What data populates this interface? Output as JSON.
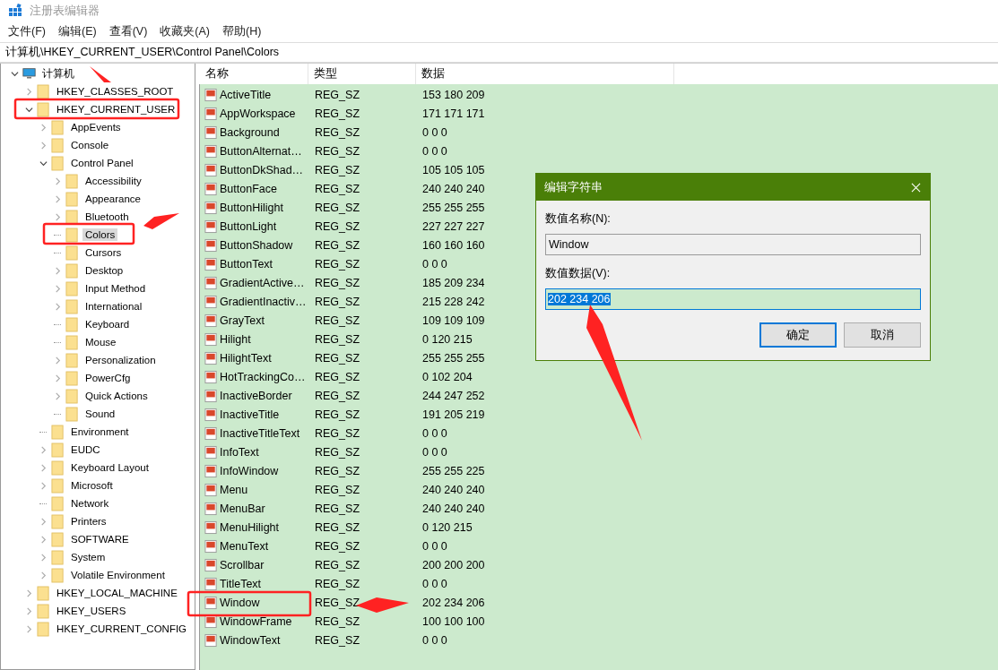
{
  "window": {
    "title": "注册表编辑器"
  },
  "menu": [
    "文件(F)",
    "编辑(E)",
    "查看(V)",
    "收藏夹(A)",
    "帮助(H)"
  ],
  "address": "计算机\\HKEY_CURRENT_USER\\Control Panel\\Colors",
  "tree": [
    {
      "label": "计算机",
      "kind": "computer",
      "expanded": true,
      "selected": false,
      "children": [
        {
          "label": "HKEY_CLASSES_ROOT",
          "expanded": false,
          "selected": false
        },
        {
          "label": "HKEY_CURRENT_USER",
          "expanded": true,
          "selected": false,
          "children": [
            {
              "label": "AppEvents",
              "expanded": false,
              "selected": false
            },
            {
              "label": "Console",
              "expanded": false,
              "selected": false
            },
            {
              "label": "Control Panel",
              "expanded": true,
              "selected": false,
              "children": [
                {
                  "label": "Accessibility",
                  "expanded": false,
                  "selected": false
                },
                {
                  "label": "Appearance",
                  "expanded": false,
                  "selected": false
                },
                {
                  "label": "Bluetooth",
                  "expanded": false,
                  "selected": false
                },
                {
                  "label": "Colors",
                  "kind": "leaf",
                  "selected": true
                },
                {
                  "label": "Cursors",
                  "kind": "leaf",
                  "selected": false
                },
                {
                  "label": "Desktop",
                  "expanded": false,
                  "selected": false
                },
                {
                  "label": "Input Method",
                  "expanded": false,
                  "selected": false
                },
                {
                  "label": "International",
                  "expanded": false,
                  "selected": false
                },
                {
                  "label": "Keyboard",
                  "kind": "leaf",
                  "selected": false
                },
                {
                  "label": "Mouse",
                  "kind": "leaf",
                  "selected": false
                },
                {
                  "label": "Personalization",
                  "expanded": false,
                  "selected": false
                },
                {
                  "label": "PowerCfg",
                  "expanded": false,
                  "selected": false
                },
                {
                  "label": "Quick Actions",
                  "expanded": false,
                  "selected": false
                },
                {
                  "label": "Sound",
                  "kind": "leaf",
                  "selected": false
                }
              ]
            },
            {
              "label": "Environment",
              "kind": "leaf",
              "selected": false
            },
            {
              "label": "EUDC",
              "expanded": false,
              "selected": false
            },
            {
              "label": "Keyboard Layout",
              "expanded": false,
              "selected": false
            },
            {
              "label": "Microsoft",
              "expanded": false,
              "selected": false
            },
            {
              "label": "Network",
              "kind": "leaf",
              "selected": false
            },
            {
              "label": "Printers",
              "expanded": false,
              "selected": false
            },
            {
              "label": "SOFTWARE",
              "expanded": false,
              "selected": false
            },
            {
              "label": "System",
              "expanded": false,
              "selected": false
            },
            {
              "label": "Volatile Environment",
              "expanded": false,
              "selected": false
            }
          ]
        },
        {
          "label": "HKEY_LOCAL_MACHINE",
          "expanded": false,
          "selected": false
        },
        {
          "label": "HKEY_USERS",
          "expanded": false,
          "selected": false
        },
        {
          "label": "HKEY_CURRENT_CONFIG",
          "expanded": false,
          "selected": false
        }
      ]
    }
  ],
  "table": {
    "columns": [
      "名称",
      "类型",
      "数据"
    ],
    "rows": [
      [
        "ActiveTitle",
        "REG_SZ",
        "153 180 209"
      ],
      [
        "AppWorkspace",
        "REG_SZ",
        "171 171 171"
      ],
      [
        "Background",
        "REG_SZ",
        "0 0 0"
      ],
      [
        "ButtonAlternat…",
        "REG_SZ",
        "0 0 0"
      ],
      [
        "ButtonDkShad…",
        "REG_SZ",
        "105 105 105"
      ],
      [
        "ButtonFace",
        "REG_SZ",
        "240 240 240"
      ],
      [
        "ButtonHilight",
        "REG_SZ",
        "255 255 255"
      ],
      [
        "ButtonLight",
        "REG_SZ",
        "227 227 227"
      ],
      [
        "ButtonShadow",
        "REG_SZ",
        "160 160 160"
      ],
      [
        "ButtonText",
        "REG_SZ",
        "0 0 0"
      ],
      [
        "GradientActive…",
        "REG_SZ",
        "185 209 234"
      ],
      [
        "GradientInactiv…",
        "REG_SZ",
        "215 228 242"
      ],
      [
        "GrayText",
        "REG_SZ",
        "109 109 109"
      ],
      [
        "Hilight",
        "REG_SZ",
        "0 120 215"
      ],
      [
        "HilightText",
        "REG_SZ",
        "255 255 255"
      ],
      [
        "HotTrackingCo…",
        "REG_SZ",
        "0 102 204"
      ],
      [
        "InactiveBorder",
        "REG_SZ",
        "244 247 252"
      ],
      [
        "InactiveTitle",
        "REG_SZ",
        "191 205 219"
      ],
      [
        "InactiveTitleText",
        "REG_SZ",
        "0 0 0"
      ],
      [
        "InfoText",
        "REG_SZ",
        "0 0 0"
      ],
      [
        "InfoWindow",
        "REG_SZ",
        "255 255 225"
      ],
      [
        "Menu",
        "REG_SZ",
        "240 240 240"
      ],
      [
        "MenuBar",
        "REG_SZ",
        "240 240 240"
      ],
      [
        "MenuHilight",
        "REG_SZ",
        "0 120 215"
      ],
      [
        "MenuText",
        "REG_SZ",
        "0 0 0"
      ],
      [
        "Scrollbar",
        "REG_SZ",
        "200 200 200"
      ],
      [
        "TitleText",
        "REG_SZ",
        "0 0 0"
      ],
      [
        "Window",
        "REG_SZ",
        "202 234 206"
      ],
      [
        "WindowFrame",
        "REG_SZ",
        "100 100 100"
      ],
      [
        "WindowText",
        "REG_SZ",
        "0 0 0"
      ]
    ]
  },
  "dialog": {
    "title": "编辑字符串",
    "name_label": "数值名称(N):",
    "name_value": "Window",
    "data_label": "数值数据(V):",
    "data_value": "202 234 206",
    "buttons": [
      {
        "label": "确定",
        "default": true
      },
      {
        "label": "取消",
        "default": false
      }
    ]
  }
}
